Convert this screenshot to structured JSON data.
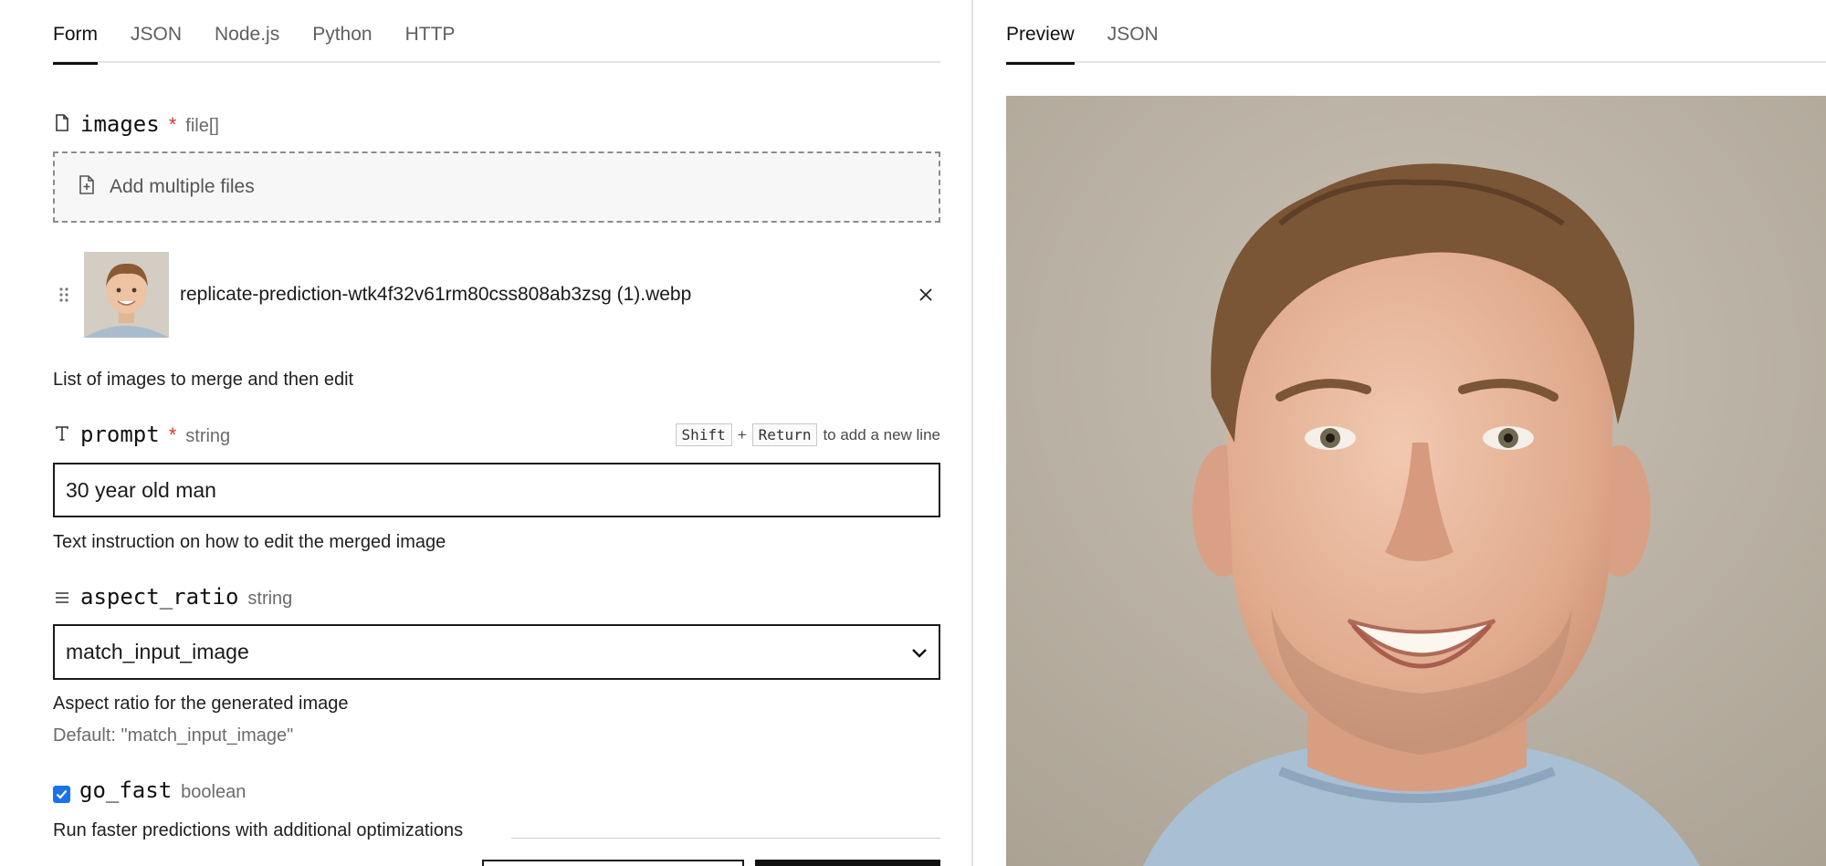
{
  "left_tabs": [
    {
      "label": "Form",
      "active": true
    },
    {
      "label": "JSON",
      "active": false
    },
    {
      "label": "Node.js",
      "active": false
    },
    {
      "label": "Python",
      "active": false
    },
    {
      "label": "HTTP",
      "active": false
    }
  ],
  "right_tabs": [
    {
      "label": "Preview",
      "active": true
    },
    {
      "label": "JSON",
      "active": false
    }
  ],
  "fields": {
    "images": {
      "name": "images",
      "required_mark": "*",
      "type": "file[]",
      "dropzone_label": "Add multiple files",
      "file_name": "replicate-prediction-wtk4f32v61rm80css808ab3zsg (1).webp",
      "description": "List of images to merge and then edit"
    },
    "prompt": {
      "name": "prompt",
      "required_mark": "*",
      "type": "string",
      "hint_key1": "Shift",
      "hint_plus": "+",
      "hint_key2": "Return",
      "hint_text": "to add a new line",
      "value": "30 year old man",
      "description": "Text instruction on how to edit the merged image"
    },
    "aspect_ratio": {
      "name": "aspect_ratio",
      "type": "string",
      "value": "match_input_image",
      "description": "Aspect ratio for the generated image",
      "default_text": "Default: \"match_input_image\""
    },
    "go_fast": {
      "name": "go_fast",
      "type": "boolean",
      "checked": true,
      "description": "Run faster predictions with additional optimizations"
    }
  },
  "colors": {
    "accent": "#1a73e8",
    "required": "#d93a2f",
    "border": "#1a1a1a"
  },
  "icons": {
    "images_field": "file-icon",
    "dropzone": "file-plus-icon",
    "prompt_field": "text-type-icon",
    "aspect_field": "list-icon",
    "remove": "close-icon",
    "drag": "drag-handle-icon",
    "select": "chevron-down-icon"
  }
}
